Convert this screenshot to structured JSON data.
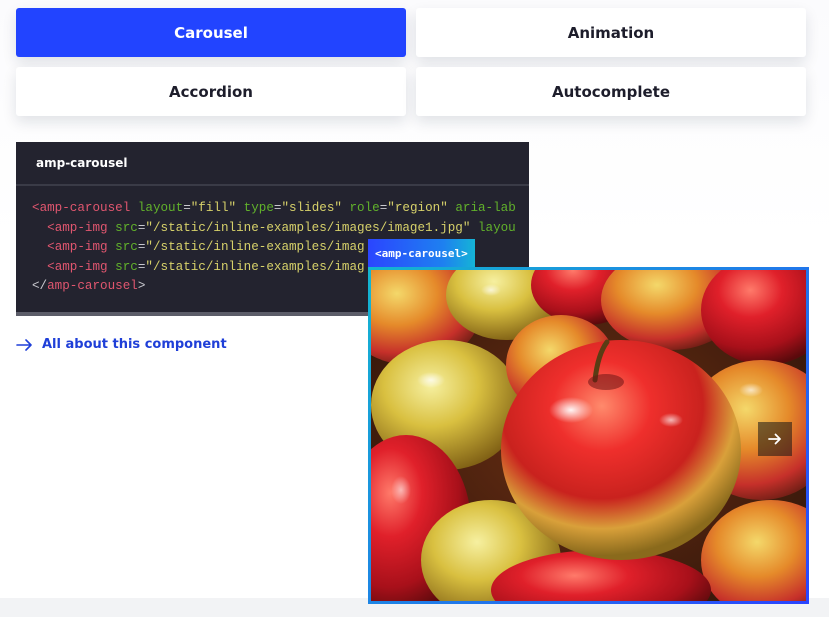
{
  "tabs": [
    {
      "label": "Carousel",
      "active": true
    },
    {
      "label": "Animation",
      "active": false
    },
    {
      "label": "Accordion",
      "active": false
    },
    {
      "label": "Autocomplete",
      "active": false
    }
  ],
  "code_panel": {
    "title": "amp-carousel",
    "lines": [
      [
        {
          "t": "<",
          "k": "tag"
        },
        {
          "t": "amp-carousel",
          "k": "tag"
        },
        {
          "t": " ",
          "k": "punct"
        },
        {
          "t": "layout",
          "k": "attr"
        },
        {
          "t": "=",
          "k": "punct"
        },
        {
          "t": "\"fill\"",
          "k": "str"
        },
        {
          "t": " ",
          "k": "punct"
        },
        {
          "t": "type",
          "k": "attr"
        },
        {
          "t": "=",
          "k": "punct"
        },
        {
          "t": "\"slides\"",
          "k": "str"
        },
        {
          "t": " ",
          "k": "punct"
        },
        {
          "t": "role",
          "k": "attr"
        },
        {
          "t": "=",
          "k": "punct"
        },
        {
          "t": "\"region\"",
          "k": "str"
        },
        {
          "t": " ",
          "k": "punct"
        },
        {
          "t": "aria-lab",
          "k": "attr"
        }
      ],
      [
        {
          "t": "  <",
          "k": "tag"
        },
        {
          "t": "amp-img",
          "k": "tag"
        },
        {
          "t": " ",
          "k": "punct"
        },
        {
          "t": "src",
          "k": "attr"
        },
        {
          "t": "=",
          "k": "punct"
        },
        {
          "t": "\"/static/inline-examples/images/image1.jpg\"",
          "k": "str"
        },
        {
          "t": " ",
          "k": "punct"
        },
        {
          "t": "layou",
          "k": "attr"
        }
      ],
      [
        {
          "t": "  <",
          "k": "tag"
        },
        {
          "t": "amp-img",
          "k": "tag"
        },
        {
          "t": " ",
          "k": "punct"
        },
        {
          "t": "src",
          "k": "attr"
        },
        {
          "t": "=",
          "k": "punct"
        },
        {
          "t": "\"/static/inline-examples/imag",
          "k": "str"
        }
      ],
      [
        {
          "t": "  <",
          "k": "tag"
        },
        {
          "t": "amp-img",
          "k": "tag"
        },
        {
          "t": " ",
          "k": "punct"
        },
        {
          "t": "src",
          "k": "attr"
        },
        {
          "t": "=",
          "k": "punct"
        },
        {
          "t": "\"/static/inline-examples/imag",
          "k": "str"
        }
      ],
      [
        {
          "t": "</",
          "k": "punct"
        },
        {
          "t": "amp-carousel",
          "k": "tag"
        },
        {
          "t": ">",
          "k": "punct"
        }
      ]
    ]
  },
  "doc_link": {
    "label": "All about this component",
    "icon": "arrow-right-icon"
  },
  "preview": {
    "badge": "<amp-carousel>",
    "image_alt": "Red and yellow apples",
    "next_button_icon": "arrow-right-icon"
  },
  "colors": {
    "accent": "#2244ff",
    "link": "#1f3fd8",
    "code_bg": "#23232f",
    "code_tag": "#e0566f",
    "code_attr": "#61b12b",
    "code_string": "#d7d16a"
  }
}
